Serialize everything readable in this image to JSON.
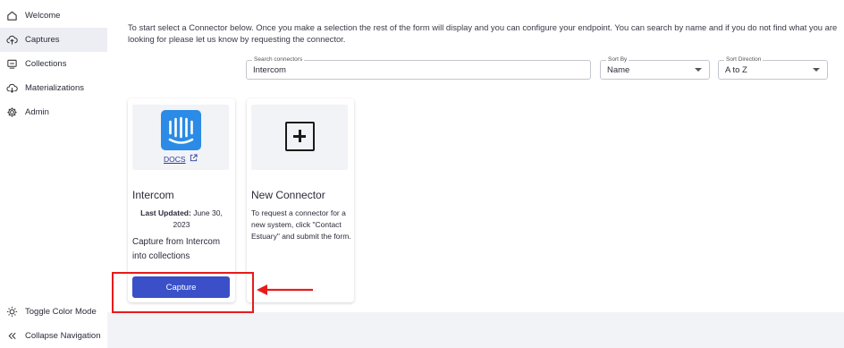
{
  "sidebar": {
    "items": [
      {
        "label": "Welcome",
        "icon": "home-icon"
      },
      {
        "label": "Captures",
        "icon": "cloud-upload-icon"
      },
      {
        "label": "Collections",
        "icon": "collections-icon"
      },
      {
        "label": "Materializations",
        "icon": "cloud-download-icon"
      },
      {
        "label": "Admin",
        "icon": "gear-icon"
      }
    ],
    "bottom": [
      {
        "label": "Toggle Color Mode",
        "icon": "sun-icon"
      },
      {
        "label": "Collapse Navigation",
        "icon": "double-chevron-left-icon"
      }
    ]
  },
  "intro": "To start select a Connector below. Once you make a selection the rest of the form will display and you can configure your endpoint. You can search by name and if you do not find what you are looking for please let us know by requesting the connector.",
  "search": {
    "label": "Search connectors",
    "value": "Intercom"
  },
  "sort_by": {
    "label": "Sort By",
    "value": "Name"
  },
  "sort_direction": {
    "label": "Sort Direction",
    "value": "A to Z"
  },
  "cards": {
    "intercom": {
      "docs": "DOCS",
      "title": "Intercom",
      "updated_label": "Last Updated:",
      "updated_value": "June 30, 2023",
      "description": "Capture from Intercom into collections",
      "button": "Capture"
    },
    "new_connector": {
      "title": "New Connector",
      "description": "To request a connector for a new system, click \"Contact Estuary\" and submit the form."
    }
  },
  "colors": {
    "primary_button": "#3a4fc8",
    "highlight": "#e81b1b",
    "intercom_logo": "#2b8be6"
  }
}
